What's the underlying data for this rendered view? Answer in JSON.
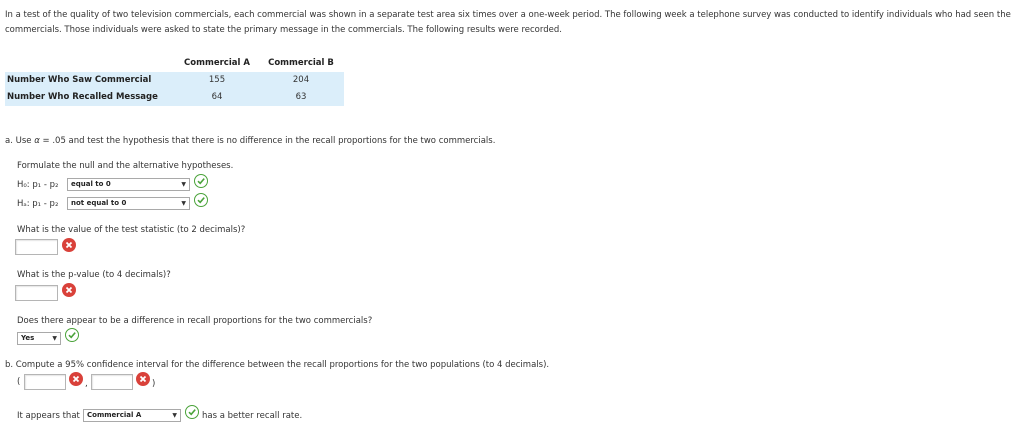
{
  "intro_text": "In a test of the quality of two television commercials, each commercial was shown in a separate test area six times over a one-week period. The following week a telephone survey was conducted to identify individuals who had seen the commercials. Those individuals were asked to state the primary message in the commercials. The following results were recorded.",
  "table": {
    "headers": [
      "",
      "Commercial A",
      "Commercial B"
    ],
    "rows": [
      {
        "label": "Number Who Saw Commercial",
        "a": "155",
        "b": "204"
      },
      {
        "label": "Number Who Recalled Message",
        "a": "64",
        "b": "63"
      }
    ]
  },
  "part_a": {
    "prompt_prefix": "a. Use ",
    "alpha_symbol": "α",
    "prompt_suffix": " = .05 and test the hypothesis that there is no difference in the recall proportions for the two commercials.",
    "formulate": "Formulate the null and the alternative hypotheses.",
    "h0_label": "H₀: p₁ - p₂",
    "h0_value": "equal to 0",
    "ha_label": "Hₐ: p₁ - p₂",
    "ha_value": "not equal to 0",
    "q_test_stat": "What is the value of the test statistic (to 2 decimals)?",
    "test_stat_value": "",
    "q_pvalue": "What is the p-value (to 4 decimals)?",
    "pvalue_value": "",
    "q_difference": "Does there appear to be a difference in recall proportions for the two commercials?",
    "difference_value": "Yes"
  },
  "part_b": {
    "prompt": "b. Compute a 95% confidence interval for the difference between the recall proportions for the two populations (to 4 decimals).",
    "open_paren": "(",
    "comma": ",",
    "close_paren": ")",
    "lower_value": "",
    "upper_value": "",
    "better_prefix": "It appears that",
    "better_value": "Commercial A",
    "better_suffix": "has a better recall rate."
  },
  "colors": {
    "table_bg": "#dbeefa",
    "correct": "#4aa33a",
    "incorrect": "#d9413a"
  },
  "icons": {
    "correct": "check-circle-icon",
    "incorrect": "x-circle-icon",
    "dropdown": "triangle-down-icon"
  }
}
